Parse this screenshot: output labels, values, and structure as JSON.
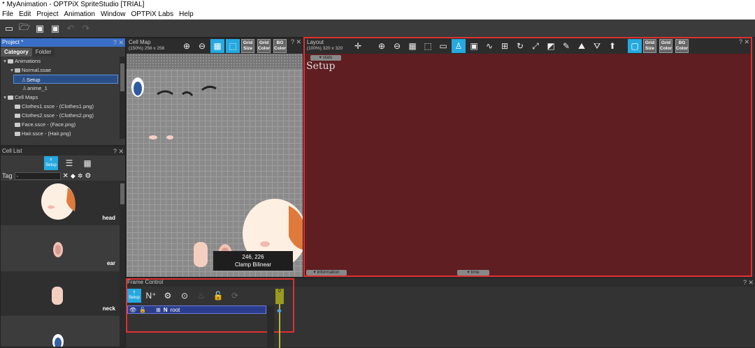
{
  "window": {
    "title": "* MyAnimation - OPTPiX SpriteStudio [TRIAL]"
  },
  "menu": [
    "File",
    "Edit",
    "Project",
    "Animation",
    "Window",
    "OPTPiX Labs",
    "Help"
  ],
  "project_panel": {
    "title": "Project *",
    "tabs": [
      "Category",
      "Folder"
    ],
    "tree": [
      {
        "label": "Animations",
        "level": 0
      },
      {
        "label": "Normal.ssae",
        "level": 1
      },
      {
        "label": "Setup",
        "level": 2,
        "selected": true
      },
      {
        "label": "anime_1",
        "level": 2
      },
      {
        "label": "Cell Maps",
        "level": 0
      },
      {
        "label": "Clothes1.ssce - (Clothes1.png)",
        "level": 1
      },
      {
        "label": "Clothes2.ssce - (Clothes2.png)",
        "level": 1
      },
      {
        "label": "Face.ssce - (Face.png)",
        "level": 1
      },
      {
        "label": "Hair.ssce - (Hair.png)",
        "level": 1
      }
    ]
  },
  "cell_list": {
    "title": "Cell List",
    "setup_label": "Setup",
    "tag_label": "Tag",
    "tag_value": "-",
    "items": [
      "head",
      "ear",
      "neck"
    ]
  },
  "cell_map": {
    "title": "Cell Map",
    "subtitle": "(150%) 256 x 256",
    "grid_size": [
      "Grid",
      "Size"
    ],
    "grid_color": [
      "Grid",
      "Color"
    ],
    "bg_color": [
      "BG",
      "Color"
    ],
    "tooltip_coords": "246, 226",
    "tooltip_mode": "Clamp  Bilinear"
  },
  "layout": {
    "title": "Layout",
    "subtitle": "(100%) 320 x 320",
    "stats_tab": "▾ stats",
    "setup_text": "Setup",
    "info_tab": "▾ information",
    "time_tab": "▾ time",
    "bg_color": "#5e1e22",
    "grid_size": [
      "Grid",
      "Size"
    ],
    "grid_color": [
      "Grid",
      "Color"
    ],
    "bg_button": [
      "BG",
      "Color"
    ]
  },
  "frame_control": {
    "title": "Frame Control",
    "setup_label": "Setup",
    "frame_number": "0",
    "root_label": "root",
    "root_prefix": "N"
  },
  "colors": {
    "accent": "#25a9e0",
    "highlight_border": "#e03030",
    "selection": "#2a4f86"
  }
}
